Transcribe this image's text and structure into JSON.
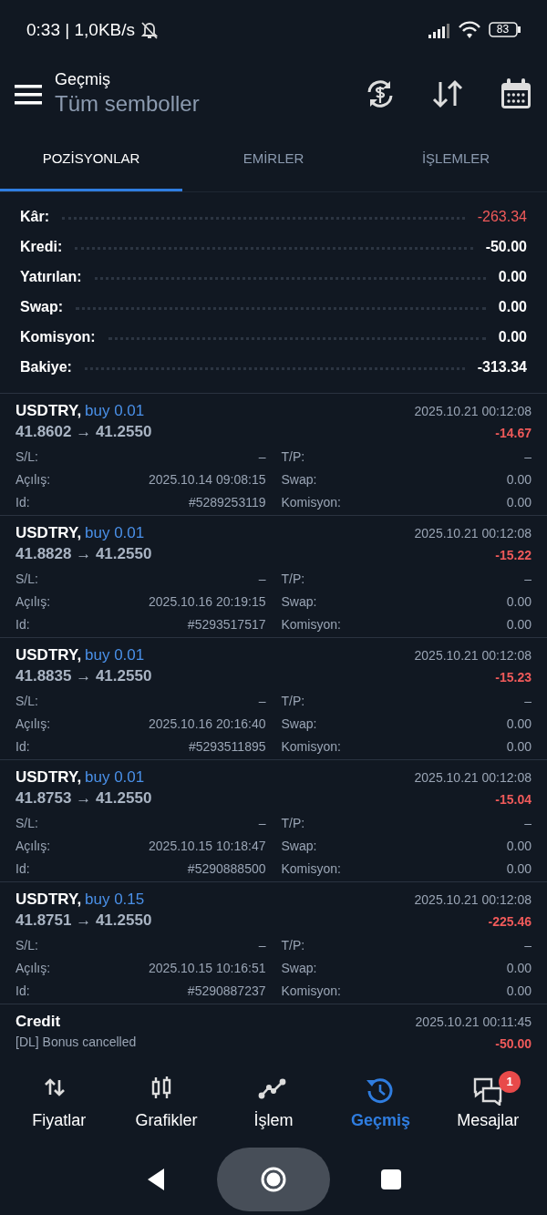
{
  "status_bar": {
    "time_speed": "0:33 | 1,0KB/s",
    "battery": "83"
  },
  "header": {
    "title": "Geçmiş",
    "subtitle": "Tüm semboller"
  },
  "tabs": [
    {
      "label": "POZİSYONLAR",
      "selected": true
    },
    {
      "label": "EMİRLER",
      "selected": false
    },
    {
      "label": "İŞLEMLER",
      "selected": false
    }
  ],
  "summary": [
    {
      "label": "Kâr:",
      "value": "-263.34",
      "kind": "loss"
    },
    {
      "label": "Kredi:",
      "value": "-50.00",
      "kind": "plain"
    },
    {
      "label": "Yatırılan:",
      "value": "0.00",
      "kind": "plain"
    },
    {
      "label": "Swap:",
      "value": "0.00",
      "kind": "plain"
    },
    {
      "label": "Komisyon:",
      "value": "0.00",
      "kind": "plain"
    },
    {
      "label": "Bakiye:",
      "value": "-313.34",
      "kind": "plain"
    }
  ],
  "deals": [
    {
      "symbol": "USDTRY,",
      "side": "buy 0.01",
      "prices": "41.8602 → 41.2550",
      "time": "2025.10.21 00:12:08",
      "profit": "-14.67",
      "fields": [
        {
          "label": "S/L:",
          "value": "–"
        },
        {
          "label": "T/P:",
          "value": "–"
        },
        {
          "label": "Açılış:",
          "value": "2025.10.14 09:08:15"
        },
        {
          "label": "Swap:",
          "value": "0.00"
        },
        {
          "label": "Id:",
          "value": "#5289253119"
        },
        {
          "label": "Komisyon:",
          "value": "0.00"
        }
      ]
    },
    {
      "symbol": "USDTRY,",
      "side": "buy 0.01",
      "prices": "41.8828 → 41.2550",
      "time": "2025.10.21 00:12:08",
      "profit": "-15.22",
      "fields": [
        {
          "label": "S/L:",
          "value": "–"
        },
        {
          "label": "T/P:",
          "value": "–"
        },
        {
          "label": "Açılış:",
          "value": "2025.10.16 20:19:15"
        },
        {
          "label": "Swap:",
          "value": "0.00"
        },
        {
          "label": "Id:",
          "value": "#5293517517"
        },
        {
          "label": "Komisyon:",
          "value": "0.00"
        }
      ]
    },
    {
      "symbol": "USDTRY,",
      "side": "buy 0.01",
      "prices": "41.8835 → 41.2550",
      "time": "2025.10.21 00:12:08",
      "profit": "-15.23",
      "fields": [
        {
          "label": "S/L:",
          "value": "–"
        },
        {
          "label": "T/P:",
          "value": "–"
        },
        {
          "label": "Açılış:",
          "value": "2025.10.16 20:16:40"
        },
        {
          "label": "Swap:",
          "value": "0.00"
        },
        {
          "label": "Id:",
          "value": "#5293511895"
        },
        {
          "label": "Komisyon:",
          "value": "0.00"
        }
      ]
    },
    {
      "symbol": "USDTRY,",
      "side": "buy 0.01",
      "prices": "41.8753 → 41.2550",
      "time": "2025.10.21 00:12:08",
      "profit": "-15.04",
      "fields": [
        {
          "label": "S/L:",
          "value": "–"
        },
        {
          "label": "T/P:",
          "value": "–"
        },
        {
          "label": "Açılış:",
          "value": "2025.10.15 10:18:47"
        },
        {
          "label": "Swap:",
          "value": "0.00"
        },
        {
          "label": "Id:",
          "value": "#5290888500"
        },
        {
          "label": "Komisyon:",
          "value": "0.00"
        }
      ]
    },
    {
      "symbol": "USDTRY,",
      "side": "buy 0.15",
      "prices": "41.8751 → 41.2550",
      "time": "2025.10.21 00:12:08",
      "profit": "-225.46",
      "fields": [
        {
          "label": "S/L:",
          "value": "–"
        },
        {
          "label": "T/P:",
          "value": "–"
        },
        {
          "label": "Açılış:",
          "value": "2025.10.15 10:16:51"
        },
        {
          "label": "Swap:",
          "value": "0.00"
        },
        {
          "label": "Id:",
          "value": "#5290887237"
        },
        {
          "label": "Komisyon:",
          "value": "0.00"
        }
      ]
    }
  ],
  "credit": {
    "title": "Credit",
    "comment": "[DL] Bonus cancelled",
    "time": "2025.10.21 00:11:45",
    "amount": "-50.00"
  },
  "bottom_nav": [
    {
      "label": "Fiyatlar",
      "kind": "quotes",
      "selected": false
    },
    {
      "label": "Grafikler",
      "kind": "charts",
      "selected": false
    },
    {
      "label": "İşlem",
      "kind": "trade",
      "selected": false
    },
    {
      "label": "Geçmiş",
      "kind": "history",
      "selected": true
    },
    {
      "label": "Mesajlar",
      "kind": "messages",
      "selected": false,
      "badge": "1"
    }
  ]
}
